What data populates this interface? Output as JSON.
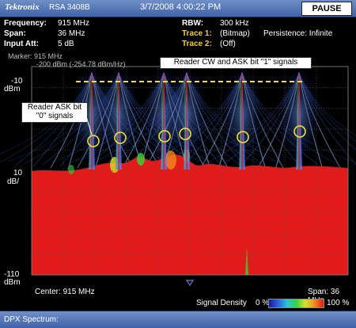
{
  "title_bar": {
    "brand": "Tektronix",
    "model": "RSA 3408B",
    "datetime": "3/7/2008 4:00:22 PM",
    "pause_label": "PAUSE"
  },
  "settings": {
    "frequency_label": "Frequency:",
    "frequency_value": "915 MHz",
    "span_label": "Span:",
    "span_value": "36 MHz",
    "input_att_label": "Input Att:",
    "input_att_value": "5 dB",
    "rbw_label": "RBW:",
    "rbw_value": "300 kHz",
    "trace1_label": "Trace 1:",
    "trace1_value": "(Bitmap)",
    "persistence_text": "Persistence: Infinite",
    "trace2_label": "Trace 2:",
    "trace2_value": "(Off)"
  },
  "marker": {
    "line1": "Marker: 915 MHz",
    "line2": "-200 dBm (-254.78 dBm/Hz)"
  },
  "y_axis": {
    "top_value": "-10",
    "top_unit": "dBm",
    "scale_value": "10",
    "scale_unit": "dB/",
    "bottom_value": "-110",
    "bottom_unit": "dBm"
  },
  "annotations": {
    "top_callout": "Reader CW and ASK bit \"1\" signals",
    "left_callout_line1": "Reader ASK bit",
    "left_callout_line2": "\"0\" signals"
  },
  "footer": {
    "center": "Center: 915 MHz",
    "span": "Span: 36 MHz",
    "density_label": "Signal Density",
    "density_low": "0 %",
    "density_high": "100 %"
  },
  "status": {
    "display_name": "DPX Spectrum:"
  },
  "colors": {
    "title_bar_blue": "#4f72b8",
    "background": "#000000",
    "grid": "#5a5a5a",
    "noise_floor_red": "#e11a1a",
    "signal_blue": "#3a6de0",
    "marker_yellow": "#f0e23a",
    "trace_yellow": "#f0d12a"
  },
  "icons": {
    "marker_triangle": "triangle-down-icon",
    "annotation_circle": "circle-highlight-icon"
  }
}
